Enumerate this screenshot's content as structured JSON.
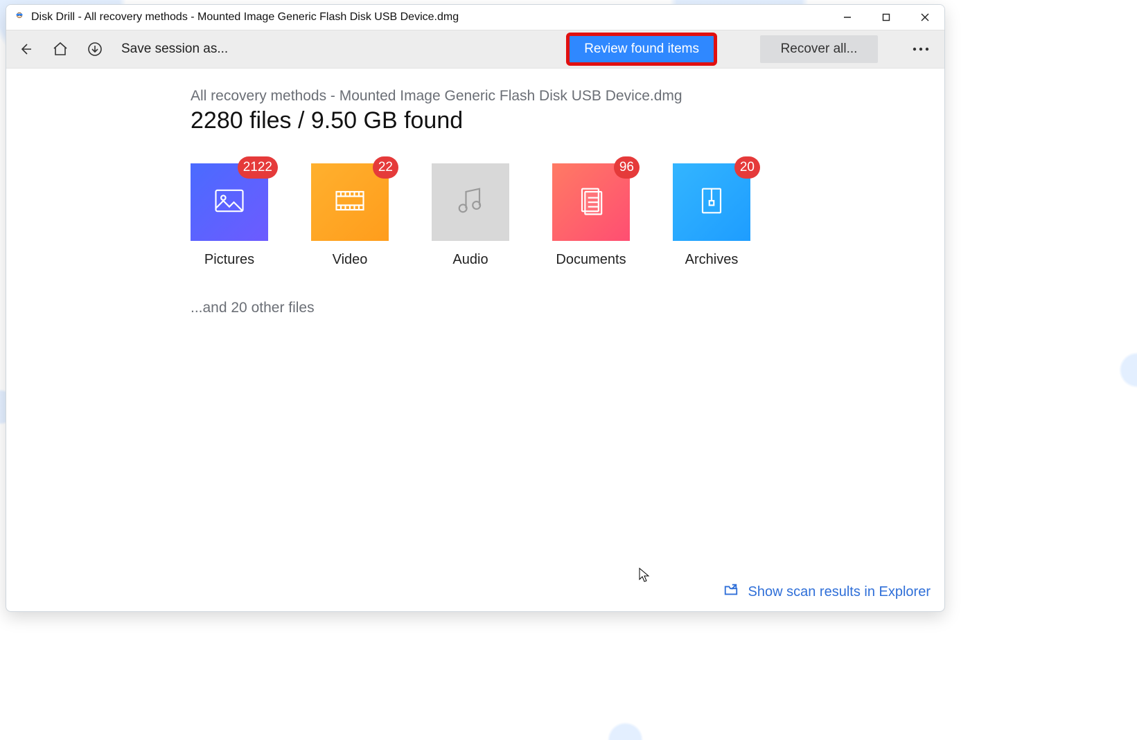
{
  "window": {
    "title": "Disk Drill - All recovery methods - Mounted Image Generic Flash Disk USB Device.dmg"
  },
  "toolbar": {
    "save_session_label": "Save session as...",
    "review_label": "Review found items",
    "recover_label": "Recover all..."
  },
  "main": {
    "breadcrumb": "All recovery methods - Mounted Image Generic Flash Disk USB Device.dmg",
    "summary": "2280 files / 9.50 GB found",
    "other_files": "...and 20 other files"
  },
  "categories": [
    {
      "key": "pictures",
      "label": "Pictures",
      "count": "2122"
    },
    {
      "key": "video",
      "label": "Video",
      "count": "22"
    },
    {
      "key": "audio",
      "label": "Audio",
      "count": null
    },
    {
      "key": "documents",
      "label": "Documents",
      "count": "96"
    },
    {
      "key": "archives",
      "label": "Archives",
      "count": "20"
    }
  ],
  "footer": {
    "show_results_label": "Show scan results in Explorer"
  },
  "highlight": {
    "review_button": true
  },
  "colors": {
    "primary": "#2f88ff",
    "badge": "#e53a3a",
    "highlight_outline": "#e11010",
    "link": "#2f6fd8"
  }
}
